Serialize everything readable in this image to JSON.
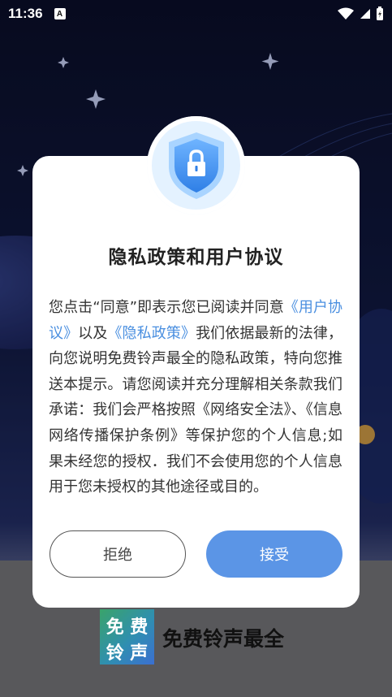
{
  "status_bar": {
    "time": "11:36",
    "notification_icon": "A"
  },
  "dialog": {
    "title": "隐私政策和用户协议",
    "body_parts": {
      "p1": "您点击“同意”即表示您已阅读并同意",
      "link1": "《用户协议》",
      "p2": "以及",
      "link2": "《隐私政策》",
      "p3": "我们依据最新的法律，向您说明免费铃声最全的隐私政策，特向您推送本提示。请您阅读并充分理解相关条款我们承诺：我们会严格按照《网络安全法》、《信息网络传播保护条例》等保护您的个人信息;如果未经您的授权．我们不会使用您的个人信息用于您未授权的其他途径或目的。"
    },
    "reject_label": "拒绝",
    "accept_label": "接受",
    "icon": "shield-lock-icon"
  },
  "app": {
    "logo_chars": [
      "免",
      "费",
      "铃",
      "声"
    ],
    "name": "免费铃声最全"
  },
  "colors": {
    "accent": "#5b95e6",
    "link": "#4a8fe0",
    "shield": "#3e8ae6"
  }
}
